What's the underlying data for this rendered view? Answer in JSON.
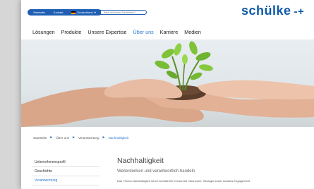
{
  "topbar": {
    "items": [
      "Startseite",
      "Kontakt"
    ],
    "country": "Deutschland",
    "search_placeholder": "Was möchten Sie finden?"
  },
  "brand": {
    "name": "schülke",
    "mark": "-+"
  },
  "nav": {
    "items": [
      "Lösungen",
      "Produkte",
      "Unsere Expertise",
      "Über uns",
      "Karriere",
      "Medien"
    ],
    "active": "Über uns"
  },
  "breadcrumb": [
    "Startseite",
    "Über uns",
    "Verantwortung",
    "Nachhaltigkeit"
  ],
  "sidenav": [
    "Unternehmensprofil",
    "Geschichte",
    "Verantwortung"
  ],
  "content": {
    "title": "Nachhaltigkeit",
    "subtitle": "Weiterdenken und verantwortlich handeln",
    "body": "Das Thema Nachhaltigkeit ist bei schülke tief verwurzelt. Ökonomie, Ökologie sowie soziales Engagement"
  },
  "colors": {
    "brand": "#0d5aa7",
    "accent": "#2a7ad1"
  }
}
